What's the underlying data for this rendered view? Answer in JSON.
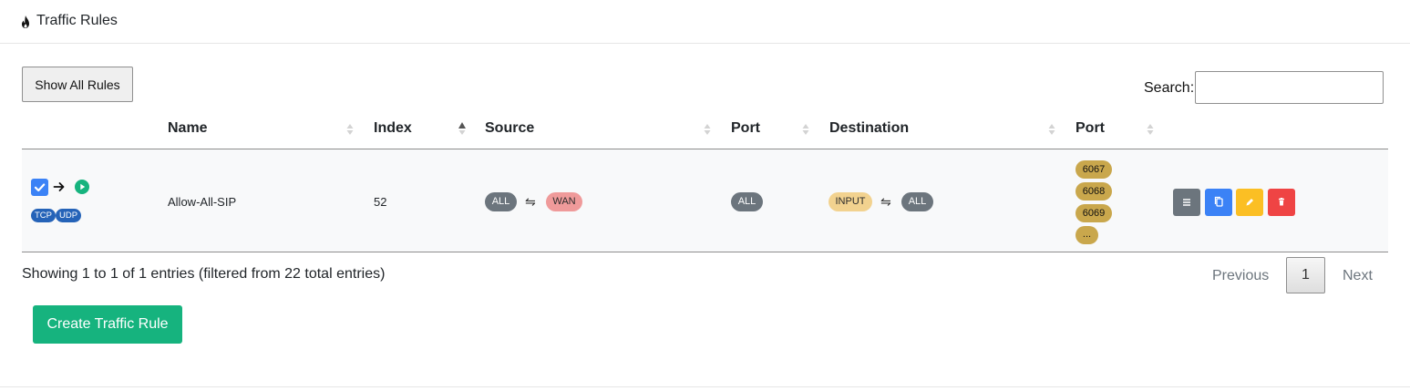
{
  "header": {
    "title": "Traffic Rules",
    "icon": "fire-icon"
  },
  "toolbar": {
    "show_all_label": "Show All Rules",
    "search_label": "Search:",
    "search_value": ""
  },
  "table": {
    "columns": [
      "Name",
      "Index",
      "Source",
      "Port",
      "Destination",
      "Port"
    ],
    "sorted_column": "Index",
    "rows": [
      {
        "enabled": true,
        "protocols": [
          "TCP",
          "UDP"
        ],
        "name": "Allow-All-SIP",
        "index": "52",
        "source_from": "ALL",
        "source_to": "WAN",
        "source_port": "ALL",
        "dest_from": "INPUT",
        "dest_to": "ALL",
        "dest_ports": [
          "6067",
          "6068",
          "6069",
          "..."
        ]
      }
    ]
  },
  "footer": {
    "info": "Showing 1 to 1 of 1 entries (filtered from 22 total entries)",
    "prev_label": "Previous",
    "page": "1",
    "next_label": "Next",
    "create_label": "Create Traffic Rule"
  },
  "colors": {
    "accent_blue": "#3b82f6",
    "success_green": "#16b37e",
    "warning_yellow": "#fbbf24",
    "danger_red": "#ef4444",
    "secondary_gray": "#6c757d"
  }
}
